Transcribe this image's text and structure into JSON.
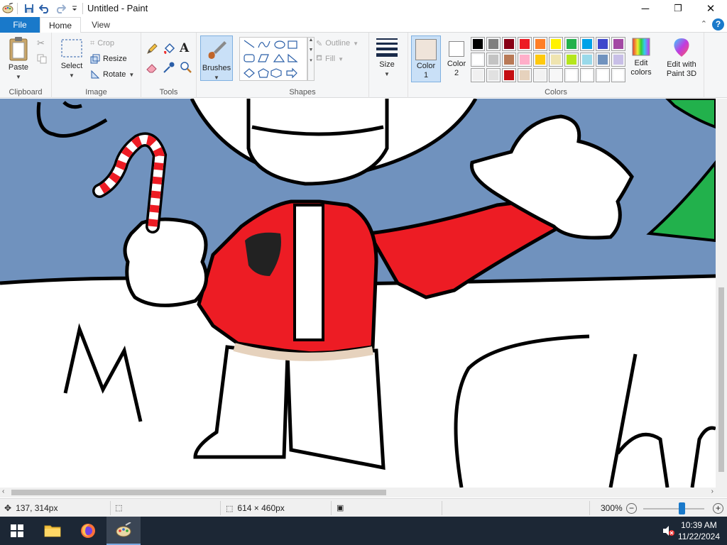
{
  "window": {
    "title": "Untitled - Paint",
    "minimize": "─",
    "maximize": "❐",
    "close": "✕"
  },
  "tabs": {
    "file": "File",
    "home": "Home",
    "view": "View",
    "help": "?"
  },
  "ribbon": {
    "clipboard": {
      "paste": "Paste",
      "label": "Clipboard"
    },
    "image": {
      "select": "Select",
      "crop": "Crop",
      "resize": "Resize",
      "rotate": "Rotate",
      "label": "Image"
    },
    "tools": {
      "label": "Tools"
    },
    "brushes": {
      "label": "Brushes"
    },
    "shapes": {
      "outline": "Outline",
      "fill": "Fill",
      "label": "Shapes"
    },
    "size": {
      "label": "Size"
    },
    "colors": {
      "color1": "Color",
      "color1_num": "1",
      "color2": "Color",
      "color2_num": "2",
      "edit": "Edit",
      "edit2": "colors",
      "label": "Colors",
      "color1_value": "#efe4da",
      "color2_value": "#ffffff",
      "palette_row1": [
        "#000000",
        "#7f7f7f",
        "#880015",
        "#ed1c24",
        "#ff7f27",
        "#fff200",
        "#22b14c",
        "#00a2e8",
        "#3f48cc",
        "#a349a4"
      ],
      "palette_row2": [
        "#ffffff",
        "#c3c3c3",
        "#b97a57",
        "#ffaec9",
        "#ffc90e",
        "#efe4b0",
        "#b5e61d",
        "#99d9ea",
        "#7092be",
        "#c8bfe7"
      ],
      "palette_row3": [
        "#f0f0f0",
        "#e1e1e1",
        "#c40e13",
        "#e6d2bd",
        "#f2f2f2",
        "#f7f7f7",
        "#ffffff",
        "#ffffff",
        "#ffffff",
        "#ffffff"
      ]
    },
    "paint3d": {
      "line1": "Edit with",
      "line2": "Paint 3D"
    }
  },
  "status": {
    "cursor_pos": "137, 314px",
    "selection_size": "",
    "image_size": "614 × 460px",
    "zoom": "300%"
  },
  "taskbar": {
    "time": "10:39 AM",
    "date": "11/22/2024"
  }
}
